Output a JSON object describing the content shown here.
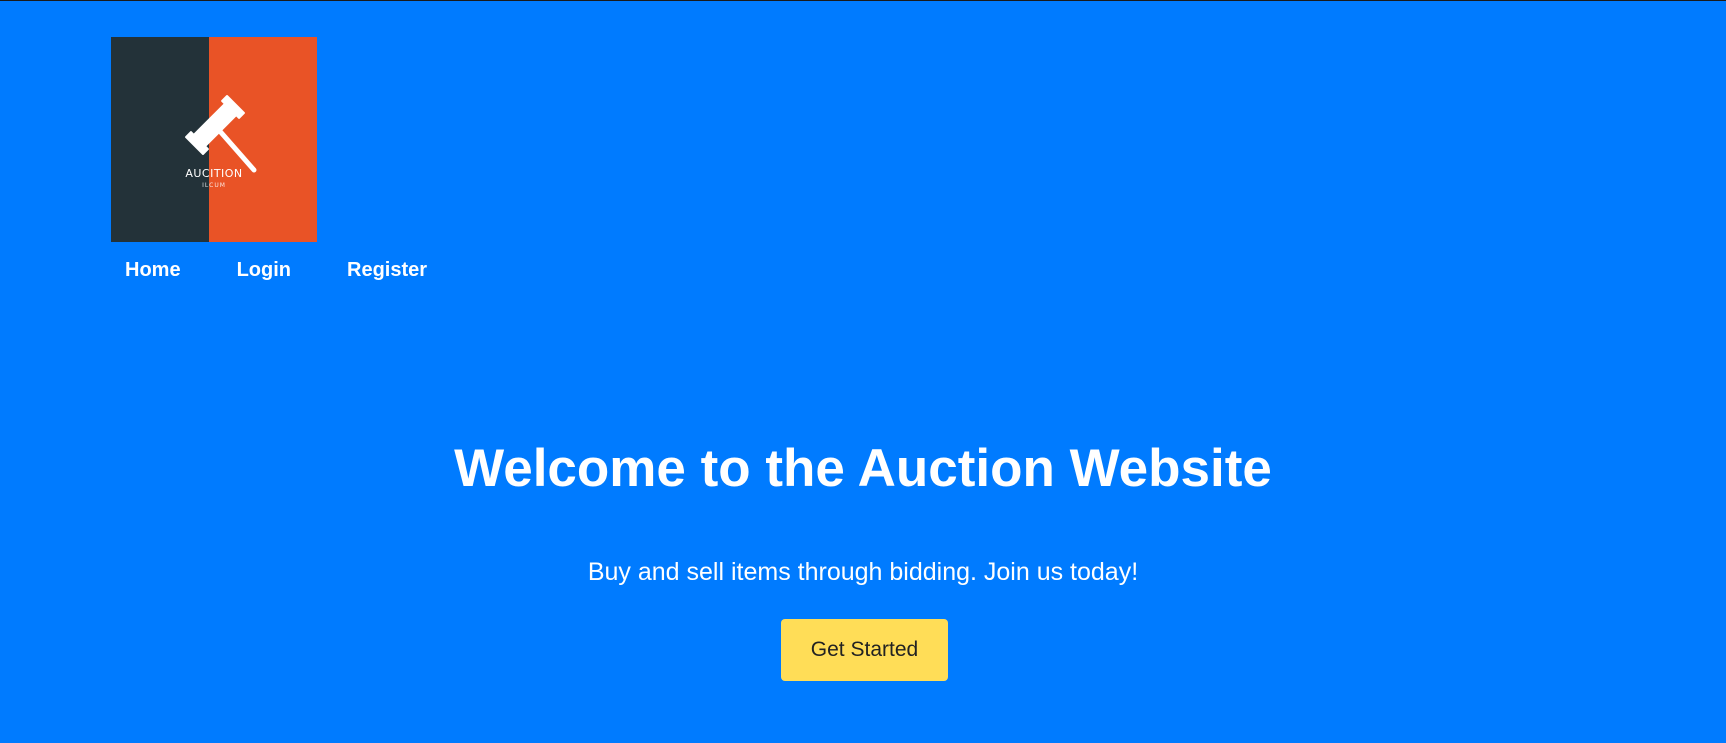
{
  "brand": {
    "logo_title": "AUCITION",
    "logo_subtitle": "ILCUM",
    "colors": {
      "logo_dark": "#233239",
      "logo_orange": "#e95326",
      "page_background": "#007bff",
      "cta_background": "#ffdd57"
    }
  },
  "nav": {
    "items": [
      {
        "label": "Home"
      },
      {
        "label": "Login"
      },
      {
        "label": "Register"
      }
    ]
  },
  "hero": {
    "title": "Welcome to the Auction Website",
    "subtitle": "Buy and sell items through bidding. Join us today!",
    "cta_label": "Get Started"
  }
}
